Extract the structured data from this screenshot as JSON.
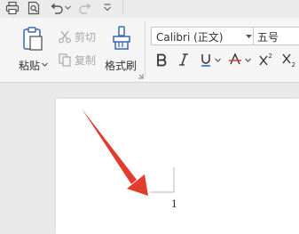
{
  "ribbon": {
    "paste_label": "粘贴",
    "cut_label": "剪切",
    "copy_label": "复制",
    "format_painter_label": "格式刷"
  },
  "font": {
    "family": "Calibri (正文)",
    "size": "五号"
  },
  "document": {
    "page_number": "1"
  },
  "colors": {
    "accent_arrow": "#e23b30",
    "ribbon_bg": "#f5f5f5",
    "doc_bg": "#e9e9e9",
    "disabled_text": "#a8a8a8"
  }
}
